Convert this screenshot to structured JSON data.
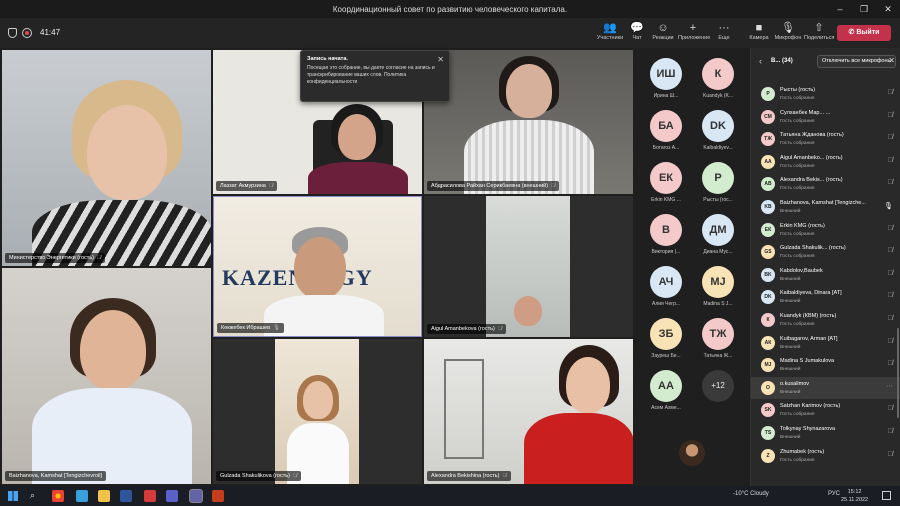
{
  "window": {
    "title": "Координационный совет по развитию человеческого капитала.",
    "controls": [
      "–",
      "❐",
      "✕"
    ]
  },
  "toolbar": {
    "timer": "41:47",
    "buttons": [
      {
        "label": "Участники",
        "icon": "people-icon",
        "glyph": "👥"
      },
      {
        "label": "Чат",
        "icon": "chat-icon",
        "glyph": "💬"
      },
      {
        "label": "Реакции",
        "icon": "reactions-icon",
        "glyph": "☺"
      },
      {
        "label": "Приложение",
        "icon": "apps-icon",
        "glyph": "+"
      },
      {
        "label": "Еще",
        "icon": "more-icon",
        "glyph": "···"
      },
      {
        "label": "Камера",
        "icon": "camera-icon",
        "glyph": "■"
      },
      {
        "label": "Микрофон",
        "icon": "microphone-icon",
        "glyph": "🎙"
      },
      {
        "label": "Поделиться",
        "icon": "share-icon",
        "glyph": "⇧"
      }
    ],
    "leave_label": "Выйти"
  },
  "notice": {
    "title": "Запись начата.",
    "body": "Посещая это собрание, вы даете согласие на запись и транскрибирование ваших слов. Политика конфиденциальности"
  },
  "tiles": [
    {
      "name": "Министерство Энергетики (гость)"
    },
    {
      "name": "Лаззат Акмурзина"
    },
    {
      "name": "Абдрасилова Райхан Серикбаевна (внешний)"
    },
    {
      "name": "Кекжебек Ибрашев",
      "banner": "KAZENERGY"
    },
    {
      "name": "Aigul Amanbekova (гость)"
    },
    {
      "name": "Baizhanova, Kamshat [Tengizchevroil]"
    },
    {
      "name": "Gulzada Shakulikova (гость)"
    },
    {
      "name": "Alexandra Bekishina (гость)"
    }
  ],
  "strip": [
    {
      "initials": "ИШ",
      "name": "Ирина Ш...",
      "color": "#d9e7f5"
    },
    {
      "initials": "К",
      "name": "Kuandyk (K...",
      "color": "#f4c9c9"
    },
    {
      "initials": "БА",
      "name": "Ботагоз А...",
      "color": "#f4c9c9"
    },
    {
      "initials": "DK",
      "name": "Kaibaldiyev...",
      "color": "#d9e7f5"
    },
    {
      "initials": "ЕК",
      "name": "Erkin KMG ...",
      "color": "#f4c9c9"
    },
    {
      "initials": "Р",
      "name": "Рысты (гос...",
      "color": "#d3ebcf"
    },
    {
      "initials": "В",
      "name": "Виктория (...",
      "color": "#f4c9c9"
    },
    {
      "initials": "ДМ",
      "name": "Диана Мус...",
      "color": "#d9e7f5"
    },
    {
      "initials": "АЧ",
      "name": "Алия Чегр...",
      "color": "#d9e7f5"
    },
    {
      "initials": "MJ",
      "name": "Madina S J...",
      "color": "#f7e3b5"
    },
    {
      "initials": "ЗБ",
      "name": "Зауреш Бе...",
      "color": "#f7e3b5"
    },
    {
      "initials": "ТЖ",
      "name": "Татьяна Ж...",
      "color": "#f4c9c9"
    },
    {
      "initials": "АА",
      "name": "Асем Ахме...",
      "color": "#d3ebcf"
    },
    {
      "initials": "+12",
      "name": ""
    }
  ],
  "panel": {
    "title": "В...",
    "count": "(34)",
    "mute_all": "Отключить все микрофоны",
    "participants": [
      {
        "initials": "Р",
        "name": "Рысты (гость)",
        "role": "Гость собрания",
        "color": "#d3ebcf",
        "mic": "🎙̸"
      },
      {
        "initials": "СМ",
        "name": "Сулханбек Мар...  ...",
        "role": "Гость собрания",
        "color": "#f4c9c9",
        "mic": "🎙̸"
      },
      {
        "initials": "ТЖ",
        "name": "Татьяна Жданова (гость)",
        "role": "Гость собрания",
        "color": "#f4c9c9",
        "mic": "🎙̸"
      },
      {
        "initials": "АА",
        "name": "Aigul Amanbeko... (гость)",
        "role": "Гость собрания",
        "color": "#f7e3b5",
        "mic": "🎙̸"
      },
      {
        "initials": "АВ",
        "name": "Alexandra Bekis...  (гость)",
        "role": "Гость собрания",
        "color": "#d3ebcf",
        "mic": "🎙̸"
      },
      {
        "initials": "KB",
        "name": "Baizhanova, Kamshat [Tengizche...",
        "role": "Внешний",
        "color": "#d9e7f5",
        "mic": "🎙"
      },
      {
        "initials": "ЕК",
        "name": "Erkin KMG (гость)",
        "role": "Гость собрания",
        "color": "#d3ebcf",
        "mic": "🎙̸"
      },
      {
        "initials": "GS",
        "name": "Gulzada Shakulik...  (гость)",
        "role": "Гость собрания",
        "color": "#f7e3b5",
        "mic": "🎙̸"
      },
      {
        "initials": "BK",
        "name": "Kabdolov,Baubek",
        "role": "Внешний",
        "color": "#d9e7f5",
        "mic": "🎙̸"
      },
      {
        "initials": "DK",
        "name": "Kaibaldiyeva, Dinara [AT]",
        "role": "Внешний",
        "color": "#d9e7f5",
        "mic": "🎙̸"
      },
      {
        "initials": "К",
        "name": "Kuandyk (КВМ) (гость)",
        "role": "Гость собрания",
        "color": "#f4c9c9",
        "mic": "🎙̸"
      },
      {
        "initials": "АК",
        "name": "Kuibagarov, Arman [AT]",
        "role": "Внешний",
        "color": "#f7e3b5",
        "mic": "🎙̸"
      },
      {
        "initials": "MJ",
        "name": "Madina S Jumakulova",
        "role": "Внешний",
        "color": "#f7e3b5",
        "mic": "🎙̸"
      },
      {
        "initials": "O",
        "name": "o.kusalimov",
        "role": "Внешний",
        "color": "#f7e3b5",
        "mic": "···"
      },
      {
        "initials": "SK",
        "name": "Satzhan Karimov (гость)",
        "role": "Гость собрания",
        "color": "#f4c9c9",
        "mic": "🎙̸"
      },
      {
        "initials": "TS",
        "name": "Tolkynay Shynazarova",
        "role": "Внешний",
        "color": "#d3ebcf",
        "mic": "🎙̸"
      },
      {
        "initials": "Z",
        "name": "Zhumabek (гость)",
        "role": "Гость собрания",
        "color": "#f7e3b5",
        "mic": "🎙̸"
      }
    ]
  },
  "taskbar": {
    "weather": "-10°C Cloudy",
    "lang": "РУС",
    "time": "15:12",
    "date": "25.11.2022"
  }
}
